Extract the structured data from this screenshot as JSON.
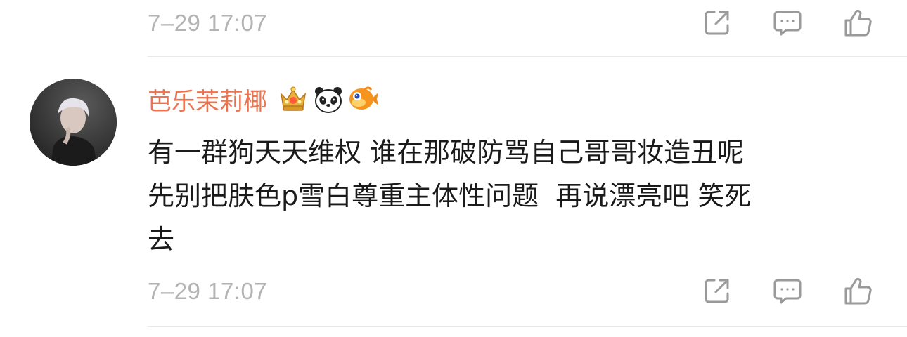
{
  "previous_comment": {
    "timestamp": "7–29 17:07"
  },
  "comment": {
    "username": "芭乐茉莉椰",
    "badges": [
      "crown-badge-icon",
      "panda-badge-icon",
      "fish-badge-icon"
    ],
    "text_lines": [
      "有一群狗天天维权 谁在那破防骂自己哥哥妆造丑呢",
      "先别把肤色p雪白尊重主体性问题  再说漂亮吧 笑死",
      "去"
    ],
    "timestamp": "7–29 17:07"
  },
  "colors": {
    "username": "#eb7350",
    "meta": "#b3b3b3",
    "icon": "#9a9a9a",
    "divider": "#e8e8e8",
    "text": "#1a1a1a"
  }
}
